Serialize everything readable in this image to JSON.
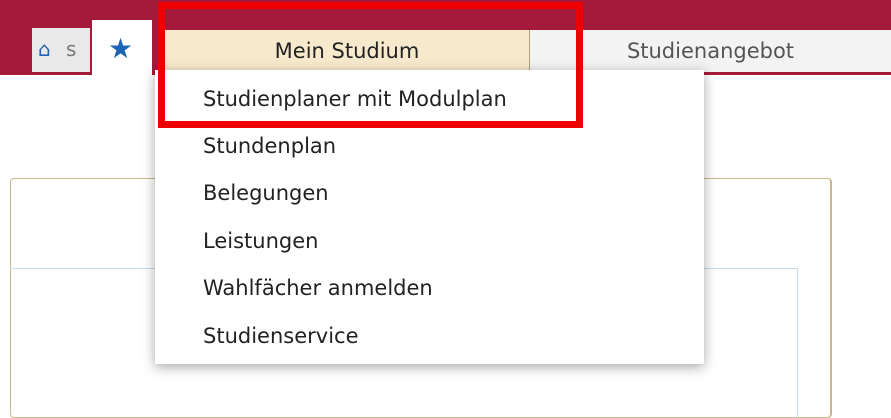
{
  "nav": {
    "home_trunc": "s",
    "tabs": [
      {
        "label": "Mein Studium",
        "active": true
      },
      {
        "label": "Studienangebot",
        "active": false
      }
    ]
  },
  "menu": {
    "items": [
      {
        "label": "Studienplaner mit Modulplan"
      },
      {
        "label": "Stundenplan"
      },
      {
        "label": "Belegungen"
      },
      {
        "label": "Leistungen"
      },
      {
        "label": "Wahlfächer anmelden"
      },
      {
        "label": "Studienservice"
      }
    ]
  },
  "colors": {
    "brand": "#a31a3a",
    "active_tab": "#f7e9cc",
    "highlight": "#ee0000",
    "icon": "#1e63b5"
  }
}
